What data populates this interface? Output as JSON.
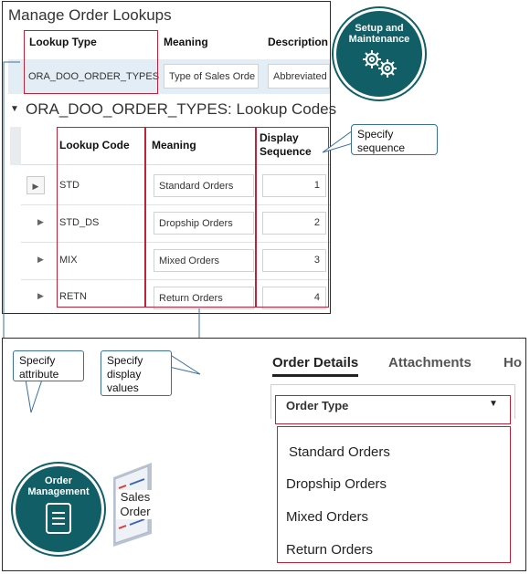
{
  "lookups_window": {
    "title": "Manage Order Lookups",
    "headers": {
      "lookup_type": "Lookup Type",
      "meaning": "Meaning",
      "description": "Description"
    },
    "row": {
      "lookup_type": "ORA_DOO_ORDER_TYPES",
      "meaning": "Type of Sales Orde",
      "description": "Abbreviated"
    },
    "codes_title": "ORA_DOO_ORDER_TYPES: Lookup Codes",
    "codes_headers": {
      "lookup_code": "Lookup Code",
      "meaning": "Meaning",
      "display_sequence_1": "Display",
      "display_sequence_2": "Sequence"
    },
    "codes": [
      {
        "code": "STD",
        "meaning": "Standard Orders",
        "sequence": "1"
      },
      {
        "code": "STD_DS",
        "meaning": "Dropship Orders",
        "sequence": "2"
      },
      {
        "code": "MIX",
        "meaning": "Mixed Orders",
        "sequence": "3"
      },
      {
        "code": "RETN",
        "meaning": "Return Orders",
        "sequence": "4"
      }
    ]
  },
  "setup_badge": {
    "line1": "Setup and",
    "line2": "Maintenance",
    "icon": "gears-icon"
  },
  "callouts": {
    "specify_sequence": {
      "line1": "Specify",
      "line2": "sequence"
    },
    "specify_attribute": {
      "line1": "Specify",
      "line2": "attribute"
    },
    "specify_display_values": {
      "line1": "Specify",
      "line2": "display",
      "line3": "values"
    }
  },
  "order_window": {
    "tabs": {
      "order_details": "Order Details",
      "attachments": "Attachments",
      "third": "Ho"
    },
    "order_type_label": "Order Type",
    "options": [
      "Standard Orders",
      "Dropship Orders",
      "Mixed Orders",
      "Return Orders"
    ]
  },
  "order_badge": {
    "line1": "Order",
    "line2": "Management",
    "icon": "document-icon"
  },
  "sales_order_doc": {
    "line1": "Sales",
    "line2": "Order"
  },
  "colors": {
    "accent_red": "#c0223a",
    "badge_teal": "#115e67",
    "callout_blue": "#3b6f9c"
  }
}
